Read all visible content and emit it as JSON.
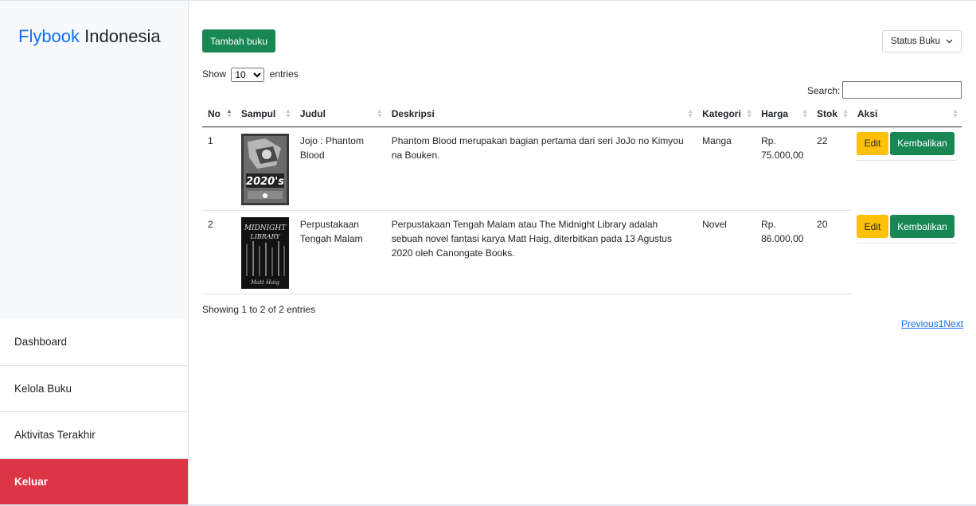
{
  "brand": {
    "part1": "Flybook",
    "part2": "Indonesia"
  },
  "nav": {
    "dashboard": "Dashboard",
    "kelola": "Kelola Buku",
    "aktivitas": "Aktivitas Terakhir",
    "keluar": "Keluar"
  },
  "toolbar": {
    "add_label": "Tambah buku",
    "status_label": "Status Buku"
  },
  "table_controls": {
    "show_prefix": "Show",
    "show_value": "10",
    "show_suffix": "entries",
    "search_label": "Search:",
    "search_value": ""
  },
  "columns": [
    "No",
    "Sampul",
    "Judul",
    "Deskripsi",
    "Kategori",
    "Harga",
    "Stok",
    "Aksi"
  ],
  "rows": [
    {
      "no": "1",
      "judul": "Jojo : Phantom Blood",
      "deskripsi": "Phantom Blood merupakan bagian pertama dari seri JoJo no Kimyou na Bouken.",
      "kategori": "Manga",
      "harga": "Rp. 75.000,00",
      "stok": "22",
      "edit_label": "Edit",
      "return_label": "Kembalikan"
    },
    {
      "no": "2",
      "judul": "Perpustakaan Tengah Malam",
      "deskripsi": "Perpustakaan Tengah Malam atau The Midnight Library adalah sebuah novel fantasi karya Matt Haig, diterbitkan pada 13 Agustus 2020 oleh Canongate Books.",
      "kategori": "Novel",
      "harga": "Rp. 86.000,00",
      "stok": "20",
      "edit_label": "Edit",
      "return_label": "Kembalikan"
    }
  ],
  "footer": {
    "info": "Showing 1 to 2 of 2 entries",
    "prev": "Previous",
    "page": "1",
    "next": "Next"
  },
  "colors": {
    "primary": "#0d6efd",
    "success": "#198754",
    "warning": "#ffc107",
    "danger": "#dc3545"
  }
}
